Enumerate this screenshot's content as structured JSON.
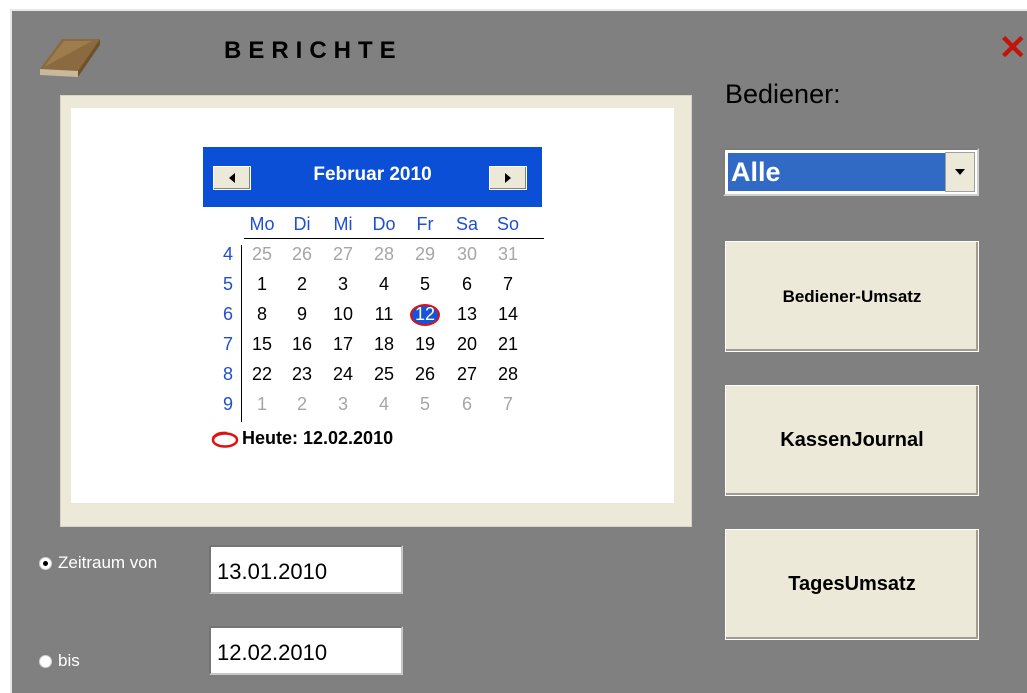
{
  "window": {
    "title": "BERICHTE"
  },
  "operator": {
    "label": "Bediener:",
    "selected": "Alle"
  },
  "buttons": {
    "operator_sales": "Bediener-Umsatz",
    "cash_journal": "KassenJournal",
    "daily_sales": "TagesUmsatz"
  },
  "calendar": {
    "month_title": "Februar 2010",
    "weekdays": [
      "Mo",
      "Di",
      "Mi",
      "Do",
      "Fr",
      "Sa",
      "So"
    ],
    "week_numbers": [
      "4",
      "5",
      "6",
      "7",
      "8",
      "9"
    ],
    "weeks": [
      [
        "25",
        "26",
        "27",
        "28",
        "29",
        "30",
        "31"
      ],
      [
        "1",
        "2",
        "3",
        "4",
        "5",
        "6",
        "7"
      ],
      [
        "8",
        "9",
        "10",
        "11",
        "12",
        "13",
        "14"
      ],
      [
        "15",
        "16",
        "17",
        "18",
        "19",
        "20",
        "21"
      ],
      [
        "22",
        "23",
        "24",
        "25",
        "26",
        "27",
        "28"
      ],
      [
        "1",
        "2",
        "3",
        "4",
        "5",
        "6",
        "7"
      ]
    ],
    "outside_month": [
      [
        true,
        true,
        true,
        true,
        true,
        true,
        true
      ],
      [
        false,
        false,
        false,
        false,
        false,
        false,
        false
      ],
      [
        false,
        false,
        false,
        false,
        false,
        false,
        false
      ],
      [
        false,
        false,
        false,
        false,
        false,
        false,
        false
      ],
      [
        false,
        false,
        false,
        false,
        false,
        false,
        false
      ],
      [
        true,
        true,
        true,
        true,
        true,
        true,
        true
      ]
    ],
    "selected_day": "12",
    "today_label": "Heute: 12.02.2010"
  },
  "range": {
    "from_label": "Zeitraum von",
    "from_value": "13.01.2010",
    "to_label": "bis",
    "to_value": "12.02.2010",
    "from_checked": true,
    "to_checked": false
  },
  "colors": {
    "window_bg": "#808080",
    "calendar_header": "#0a4fd6",
    "selection": "#316ac5",
    "close": "#c0160a",
    "today_circle": "#e01010"
  },
  "icons": {
    "book": "book-icon",
    "close": "close-icon",
    "dropdown": "chevron-down-icon",
    "prev": "triangle-left-icon",
    "next": "triangle-right-icon"
  }
}
